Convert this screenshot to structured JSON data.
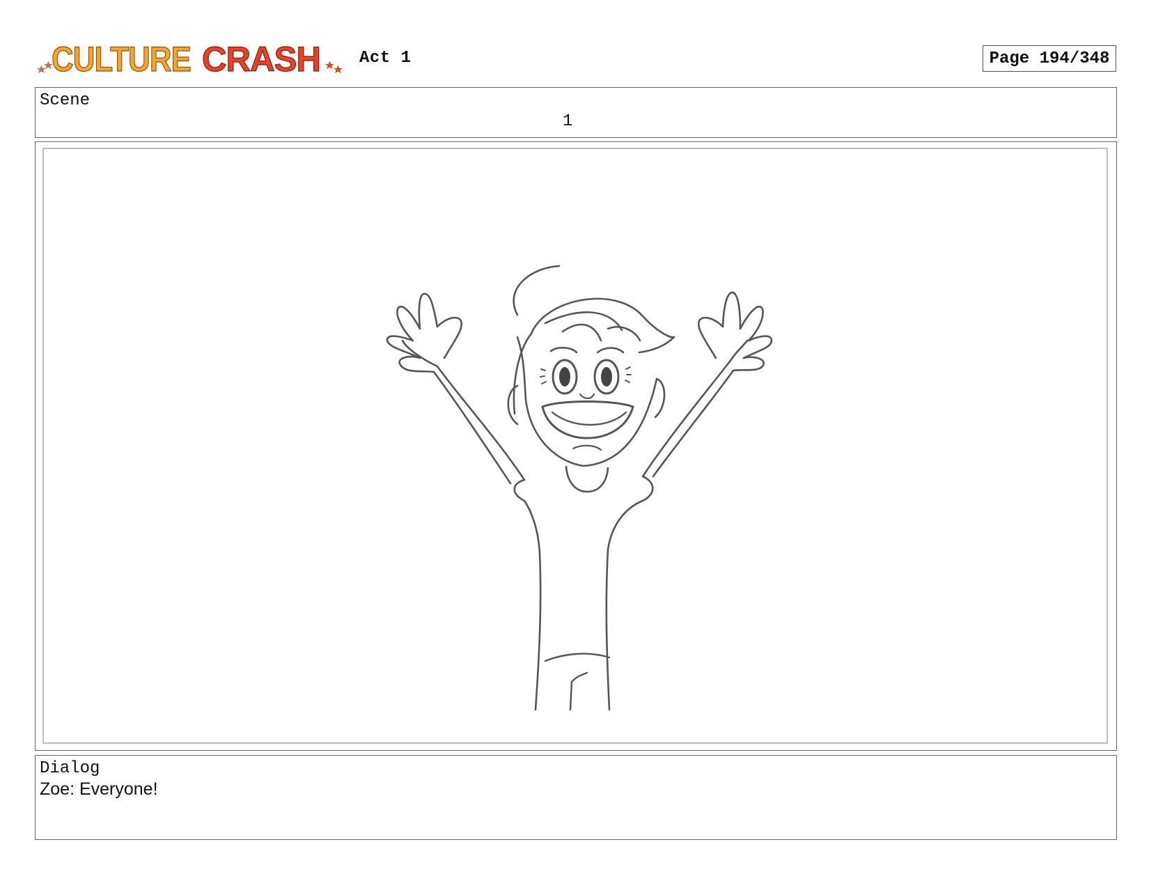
{
  "header": {
    "logo_text": "CULTURE CRASH",
    "act": "Act 1",
    "page": "Page 194/348"
  },
  "scene": {
    "label": "Scene",
    "number": "1"
  },
  "panel": {
    "subject": "pencil sketch of Zoe cheering with both arms raised"
  },
  "dialog": {
    "label": "Dialog",
    "text": "Zoe: Everyone!"
  },
  "colors": {
    "logo_orange": "#f2a62a",
    "logo_red": "#e8432a",
    "border": "#666666",
    "sketch_line": "#555555"
  }
}
